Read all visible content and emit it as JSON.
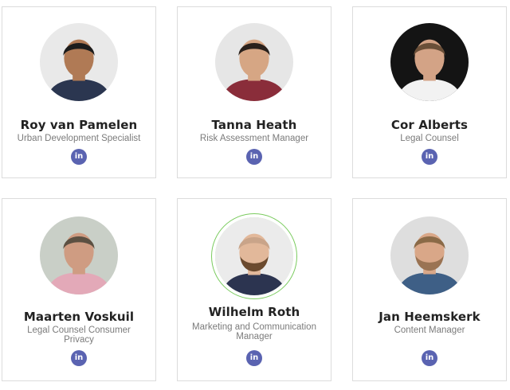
{
  "team": [
    {
      "name": "Roy van Pamelen",
      "role": "Urban Development Specialist",
      "linkedin_label": "in",
      "linkedin_icon": "linkedin-icon",
      "bg": "#e9e9e9",
      "skin": "#b07a55",
      "hair": "#1c1c1c",
      "shirt": "#2b3650"
    },
    {
      "name": "Tanna Heath",
      "role": "Risk Assessment Manager",
      "linkedin_label": "in",
      "linkedin_icon": "linkedin-icon",
      "bg": "#e6e6e6",
      "skin": "#d6a684",
      "hair": "#2a211c",
      "shirt": "#8a2d3a"
    },
    {
      "name": "Cor Alberts",
      "role": "Legal Counsel",
      "linkedin_label": "in",
      "linkedin_icon": "linkedin-icon",
      "bg": "#141414",
      "skin": "#d3a386",
      "hair": "#6a4f38",
      "shirt": "#f2f2f2"
    },
    {
      "name": "Maarten Voskuil",
      "role": "Legal Counsel Consumer Privacy",
      "linkedin_label": "in",
      "linkedin_icon": "linkedin-icon",
      "bg": "#c9cfc7",
      "skin": "#cf9c82",
      "hair": "#5c5042",
      "shirt": "#e3a9b8"
    },
    {
      "name": "Wilhelm Roth",
      "role": "Marketing and Communication Manager",
      "linkedin_label": "in",
      "linkedin_icon": "linkedin-icon",
      "bg": "#ebebeb",
      "skin": "#e2b89a",
      "hair": "#c9a489",
      "shirt": "#2c3450",
      "beard": "#6b4a2e"
    },
    {
      "name": "Jan Heemskerk",
      "role": "Content Manager",
      "linkedin_label": "in",
      "linkedin_icon": "linkedin-icon",
      "bg": "#dedede",
      "skin": "#d9a788",
      "hair": "#8a6a47",
      "shirt": "#3e5f86",
      "beard": "#9a7353"
    }
  ]
}
